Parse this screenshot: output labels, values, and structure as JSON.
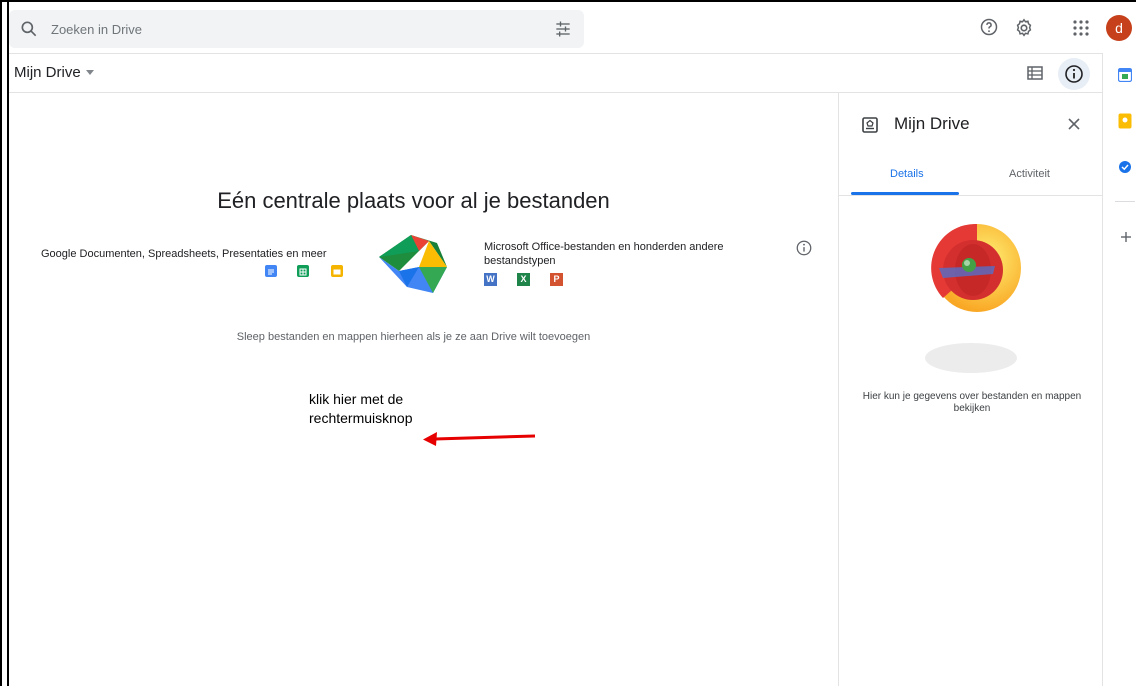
{
  "search": {
    "placeholder": "Zoeken in Drive"
  },
  "user": {
    "avatar_letter": "d",
    "avatar_color": "#c5401b"
  },
  "breadcrumb": {
    "title": "Mijn Drive"
  },
  "main": {
    "title": "Eén centrale plaats voor al je bestanden",
    "left_desc": "Google Documenten, Spreadsheets, Presentaties en meer",
    "right_desc": "Microsoft Office-bestanden en honderden andere bestandstypen",
    "ms_icons": [
      "W",
      "X",
      "P"
    ],
    "drop_hint": "Sleep bestanden en mappen hierheen als je ze aan Drive wilt toevoegen"
  },
  "annotation": {
    "line1": "klik hier met de",
    "line2": "rechtermuisknop",
    "arrow_color": "#e60000"
  },
  "side_panel": {
    "title": "Mijn Drive",
    "tabs": [
      {
        "label": "Details"
      },
      {
        "label": "Activiteit"
      }
    ],
    "info_text": "Hier kun je gegevens over bestanden en mappen bekijken"
  },
  "colors": {
    "accent": "#1a73e8",
    "docs": "#4285f4",
    "sheets": "#0f9d58",
    "slides": "#f4b400"
  }
}
